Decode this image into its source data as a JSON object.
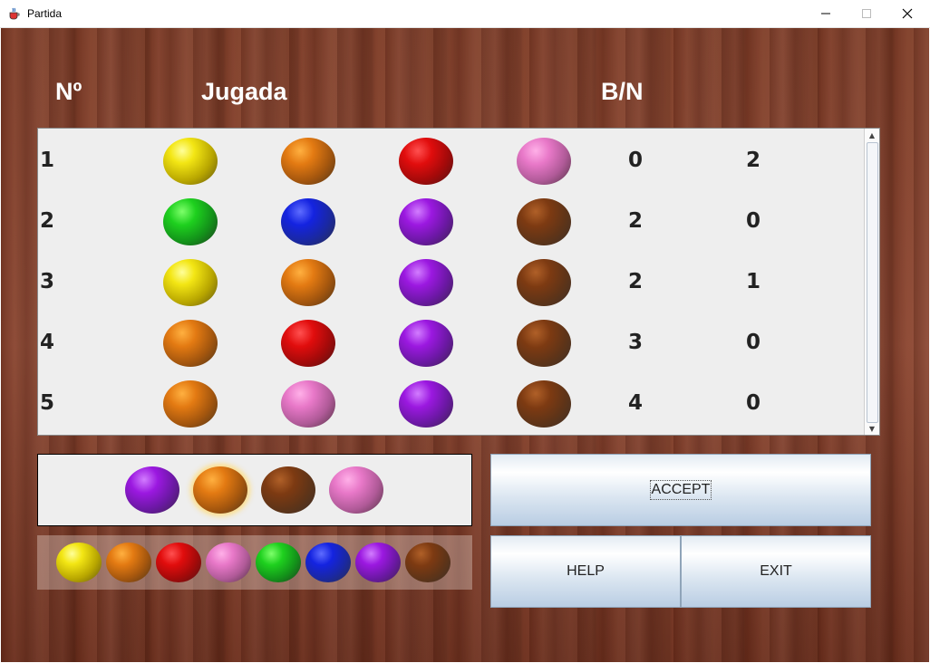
{
  "window": {
    "title": "Partida",
    "app_icon": "java-cup-icon"
  },
  "headers": {
    "number": "Nº",
    "play": "Jugada",
    "score": "B/N"
  },
  "colors": {
    "yellow": "#f3e614",
    "orange": "#e37a12",
    "red": "#e10d0d",
    "pink": "#e878c8",
    "green": "#1ed01e",
    "blue": "#1423e0",
    "purple": "#9b18e0",
    "brown": "#7d3a12"
  },
  "rows": [
    {
      "n": "1",
      "balls": [
        "yellow",
        "orange",
        "red",
        "pink"
      ],
      "b": "0",
      "w": "2"
    },
    {
      "n": "2",
      "balls": [
        "green",
        "blue",
        "purple",
        "brown"
      ],
      "b": "2",
      "w": "0"
    },
    {
      "n": "3",
      "balls": [
        "yellow",
        "orange",
        "purple",
        "brown"
      ],
      "b": "2",
      "w": "1"
    },
    {
      "n": "4",
      "balls": [
        "orange",
        "red",
        "purple",
        "brown"
      ],
      "b": "3",
      "w": "0"
    },
    {
      "n": "5",
      "balls": [
        "orange",
        "pink",
        "purple",
        "brown"
      ],
      "b": "4",
      "w": "0"
    }
  ],
  "current_guess": {
    "balls": [
      "purple",
      "orange",
      "brown",
      "pink"
    ],
    "selected_index": 1
  },
  "palette": [
    "yellow",
    "orange",
    "red",
    "pink",
    "green",
    "blue",
    "purple",
    "brown"
  ],
  "buttons": {
    "accept": "ACCEPT",
    "help": "HELP",
    "exit": "EXIT"
  }
}
